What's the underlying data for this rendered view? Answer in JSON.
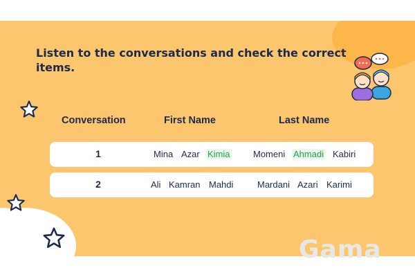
{
  "instruction": "Listen to the conversations and check the correct items.",
  "headers": {
    "conversation": "Conversation",
    "first_name": "First Name",
    "last_name": "Last Name"
  },
  "rows": [
    {
      "number": "1",
      "first_names": [
        "Mina",
        "Azar",
        "Kimia"
      ],
      "last_names": [
        "Momeni",
        "Ahmadi",
        "Kabiri"
      ],
      "checked_first": "Kimia",
      "checked_last": "Ahmadi"
    },
    {
      "number": "2",
      "first_names": [
        "Ali",
        "Kamran",
        "Mahdi"
      ],
      "last_names": [
        "Mardani",
        "Azari",
        "Karimi"
      ]
    }
  ],
  "watermark": "Gama",
  "colors": {
    "background": "#fcc66e",
    "accent_orange": "#fdb649",
    "text": "#1c2a4a",
    "checked": "#22a24a"
  },
  "icons": [
    "star-icon",
    "chatting-kids-icon"
  ]
}
